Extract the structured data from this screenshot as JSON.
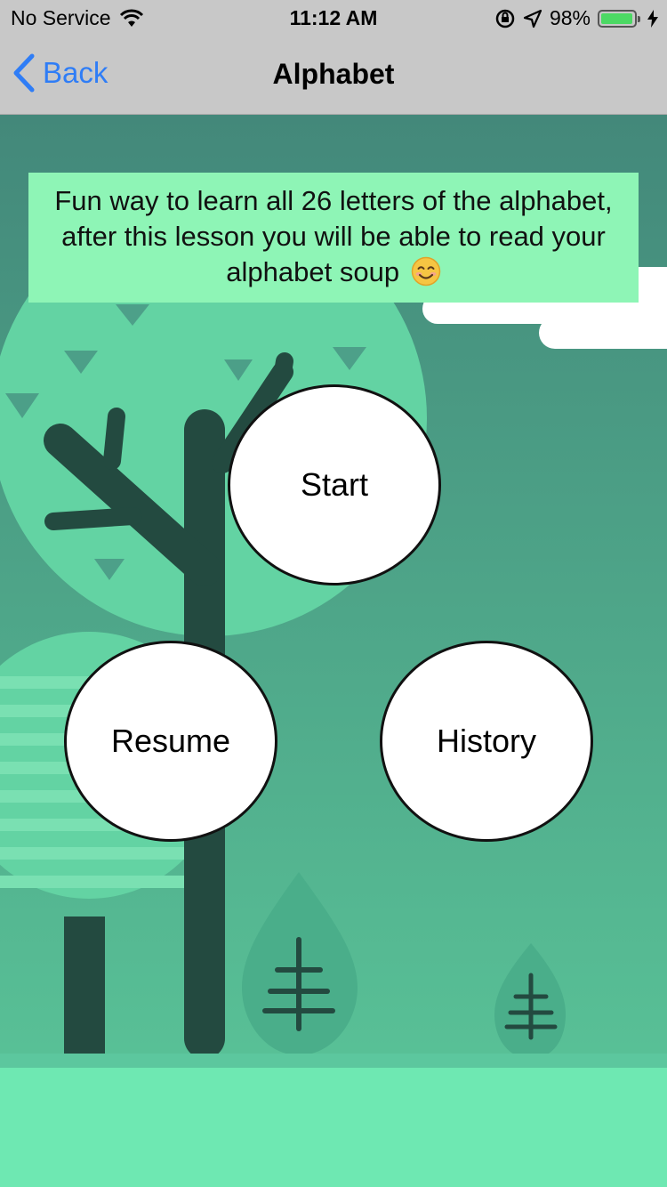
{
  "status_bar": {
    "carrier": "No Service",
    "time": "11:12 AM",
    "battery_percent": "98%",
    "battery_level": 0.98,
    "icons": [
      "wifi-icon",
      "orientation-lock-icon",
      "location-arrow-icon",
      "battery-icon",
      "charging-bolt-icon"
    ]
  },
  "nav": {
    "back_label": "Back",
    "title": "Alphabet",
    "accent_color": "#2f7df6"
  },
  "description": {
    "text": "Fun way to learn all 26 letters of the alphabet, after this lesson you will be able to read your alphabet soup",
    "emoji_icon": "smiling-face-icon",
    "background_color": "#8ef5b6"
  },
  "buttons": {
    "start_label": "Start",
    "resume_label": "Resume",
    "history_label": "History"
  },
  "colors": {
    "background_teal": "#4a9a86",
    "ground": "#6ee8b2",
    "tree_trunk": "#234a40",
    "canopy": "#63d3a3"
  }
}
